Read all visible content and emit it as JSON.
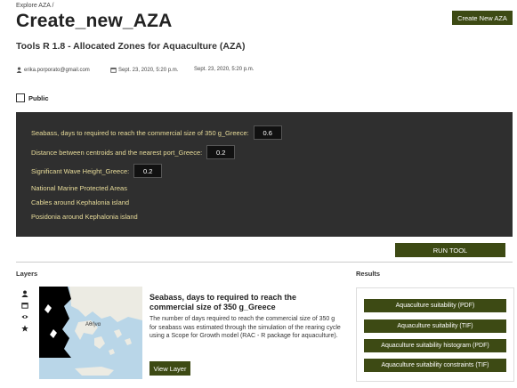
{
  "breadcrumb": "Explore AZA /",
  "page_title": "Create_new_AZA",
  "subtitle": "Tools R 1.8 - Allocated Zones for Aquaculture (AZA)",
  "create_button": "Create New AZA",
  "meta": {
    "author": "erika.porporato@gmail.com",
    "created": "Sept. 23, 2020, 5:20 p.m.",
    "modified": "Sept. 23, 2020, 5:20 p.m."
  },
  "public_label": "Public",
  "parameters": [
    {
      "label": "Seabass, days to required to reach the commercial size of 350 g_Greece:",
      "value": "0.6"
    },
    {
      "label": "Distance between centroids and the nearest port_Greece:",
      "value": "0.2"
    },
    {
      "label": "Significant Wave Height_Greece:",
      "value": "0.2"
    }
  ],
  "panel_layers": [
    "National Marine Protected Areas",
    "Cables around Kephalonia island",
    "Posidonia around Kephalonia island"
  ],
  "run_button": "RUN TOOL",
  "layers_heading": "Layers",
  "results_heading": "Results",
  "layer": {
    "title": "Seabass, days to required to reach the commercial size of 350 g_Greece",
    "description": "The number of days required to reach the commercial size of 350 g for seabass was estimated through the simulation of the rearing cycle using a Scope for Growth model (RAC - R package for aquaculture).",
    "view_button": "View Layer",
    "map_label": "Αθήνα"
  },
  "results": [
    "Aquaculture suitability (PDF)",
    "Aquaculture suitability (TIF)",
    "Aquaculture suitability histogram (PDF)",
    "Aquaculture suitability constraints (TIF)"
  ],
  "colors": {
    "accent": "#3d4a14",
    "panel_bg": "#2f2f2f",
    "panel_text": "#e8dc9a",
    "sea": "#b9d6e8",
    "land": "#ecebe3"
  }
}
